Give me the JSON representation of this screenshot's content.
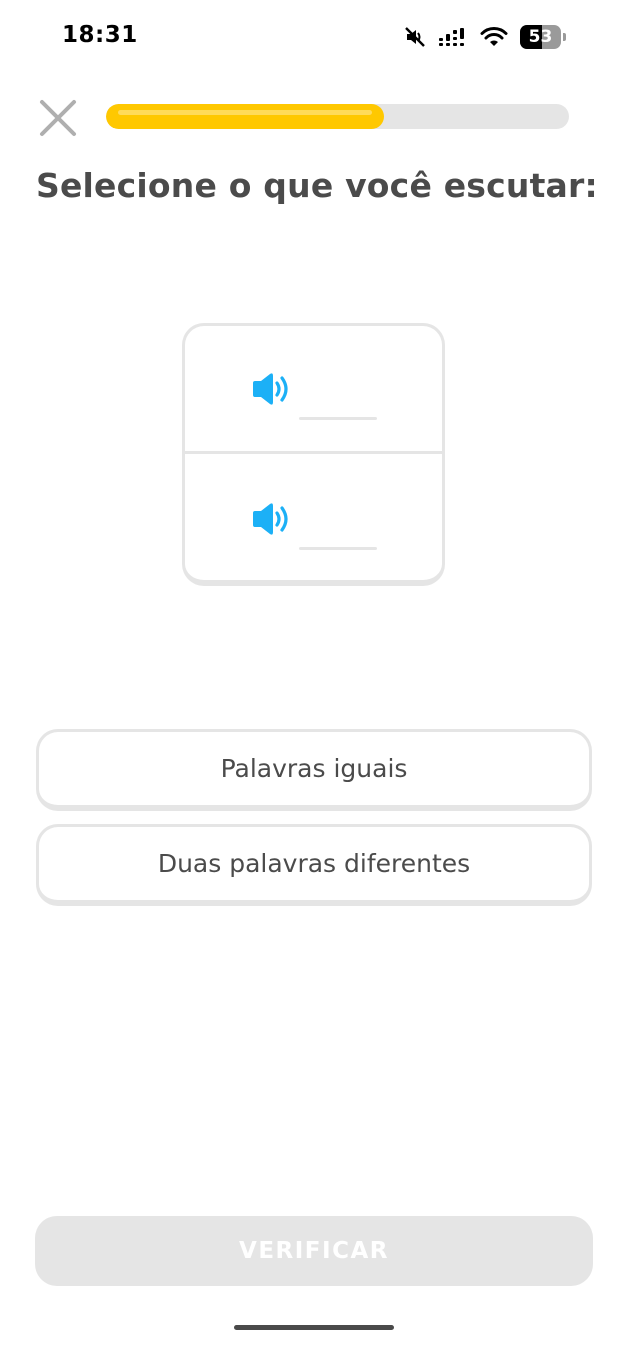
{
  "status_bar": {
    "time": "18:31",
    "battery_level": "53",
    "battery_fraction": 0.53,
    "icons": [
      "mute-icon",
      "cellular-signal-icon",
      "wifi-icon",
      "battery-icon"
    ]
  },
  "header": {
    "close_icon": "close-icon",
    "progress_fraction": 0.6,
    "progress_color": "#ffc800"
  },
  "prompt": "Selecione o que você escutar:",
  "audio": {
    "icon": "speaker-icon",
    "accent": "#1cb0f6",
    "rows": 2
  },
  "options": [
    {
      "label": "Palavras iguais"
    },
    {
      "label": "Duas palavras diferentes"
    }
  ],
  "verify_label": "VERIFICAR",
  "colors": {
    "border": "#e5e5e5",
    "text": "#4b4b4b"
  }
}
